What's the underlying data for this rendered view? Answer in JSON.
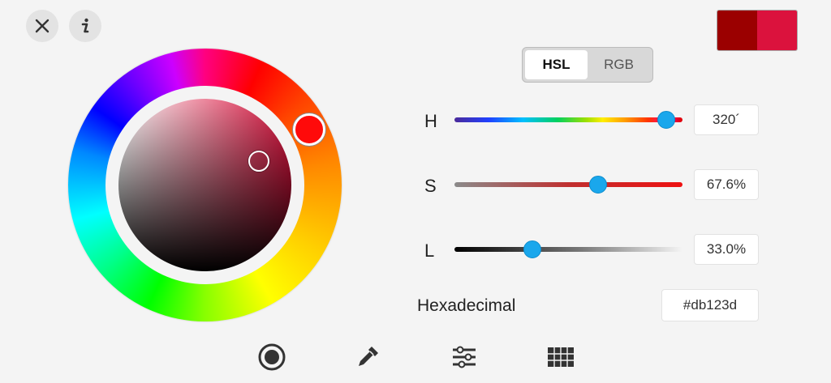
{
  "toolbar": {
    "close_icon": "close-icon",
    "info_icon": "info-icon"
  },
  "swatches": {
    "previous_color": "#9b0000",
    "current_color": "#db123d"
  },
  "mode": {
    "options": [
      "HSL",
      "RGB"
    ],
    "selected": "HSL"
  },
  "channels": [
    {
      "label": "H",
      "value_text": "320´",
      "fraction": 0.93
    },
    {
      "label": "S",
      "value_text": "67.6%",
      "fraction": 0.63
    },
    {
      "label": "L",
      "value_text": "33.0%",
      "fraction": 0.34
    }
  ],
  "hex": {
    "label": "Hexadecimal",
    "value": "#db123d"
  },
  "colors": {
    "accent": "#1aa7ec",
    "current": "#db123d"
  },
  "bottom_tools": [
    "wheel-picker-icon",
    "eyedropper-icon",
    "sliders-icon",
    "swatch-grid-icon"
  ]
}
